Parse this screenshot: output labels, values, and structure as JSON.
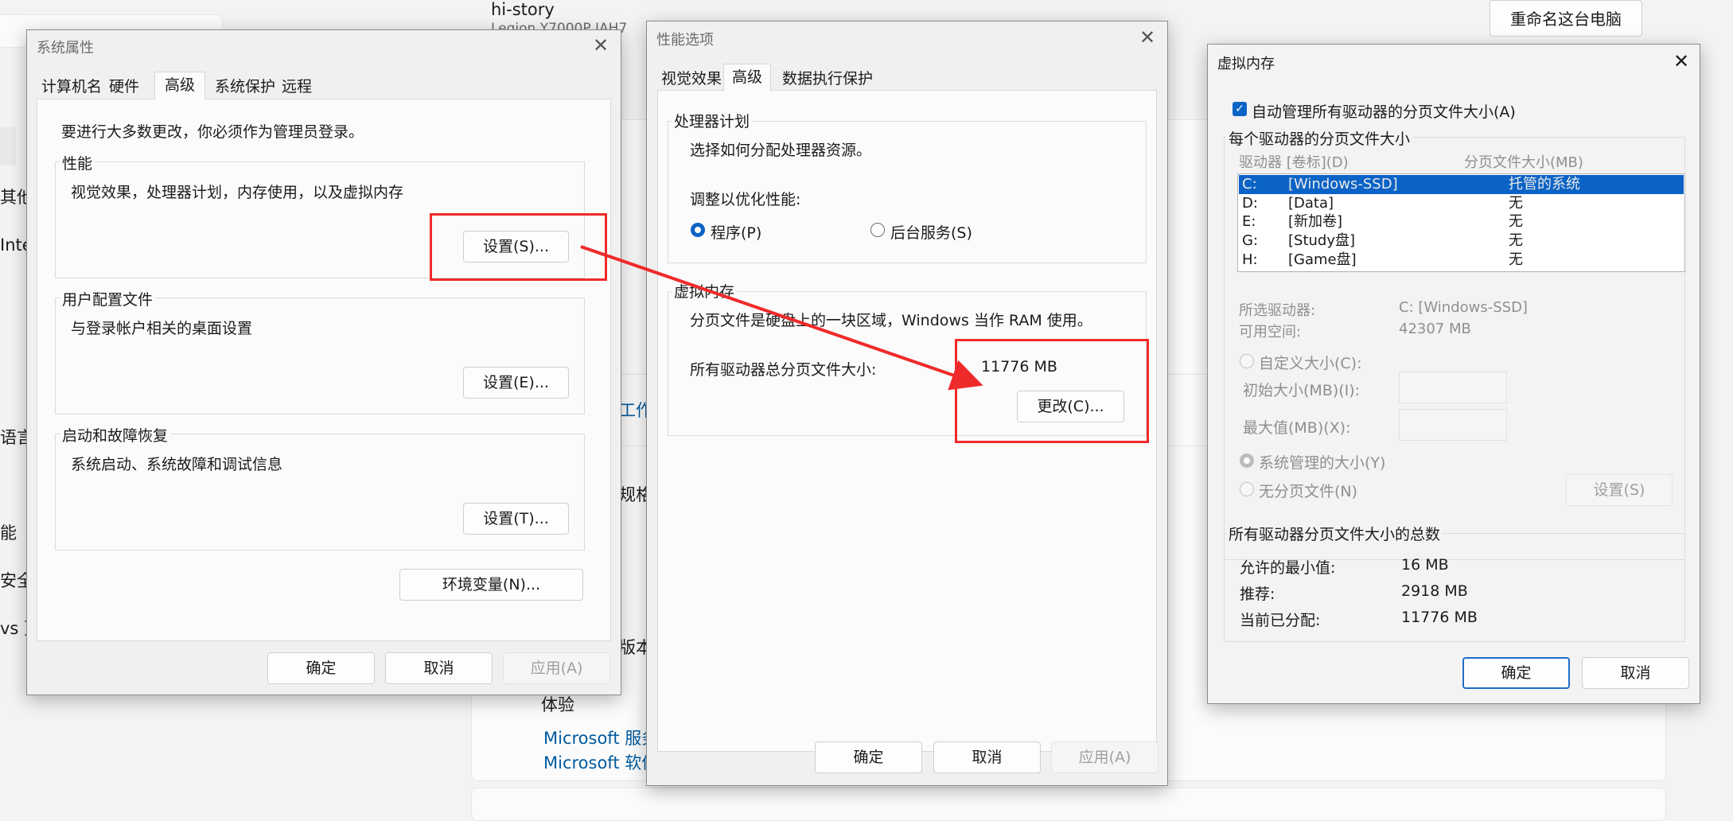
{
  "background": {
    "header_title": "hi-story",
    "header_subtitle": "Legion Y7000P IAH7",
    "rename_button": "重命名这台电脑",
    "left_fragments": [
      "其他",
      "Inter",
      "语言",
      "能",
      "安全",
      "vs 更"
    ],
    "middle_fragments": [
      "工作",
      "规格",
      "版本"
    ],
    "experience_label": "体验",
    "link_services": "Microsoft 服务",
    "link_software": "Microsoft 软件"
  },
  "sysprops": {
    "title": "系统属性",
    "tabs": [
      "计算机名",
      "硬件",
      "高级",
      "系统保护",
      "远程"
    ],
    "admin_note": "要进行大多数更改，你必须作为管理员登录。",
    "performance": {
      "label": "性能",
      "desc": "视觉效果，处理器计划，内存使用，以及虚拟内存",
      "button": "设置(S)..."
    },
    "profiles": {
      "label": "用户配置文件",
      "desc": "与登录帐户相关的桌面设置",
      "button": "设置(E)..."
    },
    "startup": {
      "label": "启动和故障恢复",
      "desc": "系统启动、系统故障和调试信息",
      "button": "设置(T)..."
    },
    "env_button": "环境变量(N)...",
    "ok": "确定",
    "cancel": "取消",
    "apply": "应用(A)"
  },
  "perfopts": {
    "title": "性能选项",
    "tabs": [
      "视觉效果",
      "高级",
      "数据执行保护"
    ],
    "processor": {
      "label": "处理器计划",
      "desc": "选择如何分配处理器资源。",
      "adjust": "调整以优化性能:",
      "programs": "程序(P)",
      "services": "后台服务(S)"
    },
    "vm": {
      "label": "虚拟内存",
      "desc": "分页文件是硬盘上的一块区域，Windows 当作 RAM 使用。",
      "total_label": "所有驱动器总分页文件大小:",
      "total_value": "11776 MB",
      "change_button": "更改(C)..."
    },
    "ok": "确定",
    "cancel": "取消",
    "apply": "应用(A)"
  },
  "vmem": {
    "title": "虚拟内存",
    "auto_manage": "自动管理所有驱动器的分页文件大小(A)",
    "per_drive_label": "每个驱动器的分页文件大小",
    "col_drive": "驱动器 [卷标](D)",
    "col_size": "分页文件大小(MB)",
    "drives": [
      {
        "letter": "C:",
        "label": "[Windows-SSD]",
        "size": "托管的系统"
      },
      {
        "letter": "D:",
        "label": "[Data]",
        "size": "无"
      },
      {
        "letter": "E:",
        "label": "[新加卷]",
        "size": "无"
      },
      {
        "letter": "G:",
        "label": "[Study盘]",
        "size": "无"
      },
      {
        "letter": "H:",
        "label": "[Game盘]",
        "size": "无"
      }
    ],
    "selected_drive_label": "所选驱动器:",
    "selected_drive_value": "C:  [Windows-SSD]",
    "free_space_label": "可用空间:",
    "free_space_value": "42307 MB",
    "custom_size": "自定义大小(C):",
    "initial_size": "初始大小(MB)(I):",
    "max_size": "最大值(MB)(X):",
    "system_managed": "系统管理的大小(Y)",
    "no_paging": "无分页文件(N)",
    "set_button": "设置(S)",
    "totals_label": "所有驱动器分页文件大小的总数",
    "min_label": "允许的最小值:",
    "min_value": "16 MB",
    "rec_label": "推荐:",
    "rec_value": "2918 MB",
    "cur_label": "当前已分配:",
    "cur_value": "11776 MB",
    "ok": "确定",
    "cancel": "取消"
  },
  "colors": {
    "highlight": "#ef2a2a",
    "accent": "#0b63c6"
  }
}
